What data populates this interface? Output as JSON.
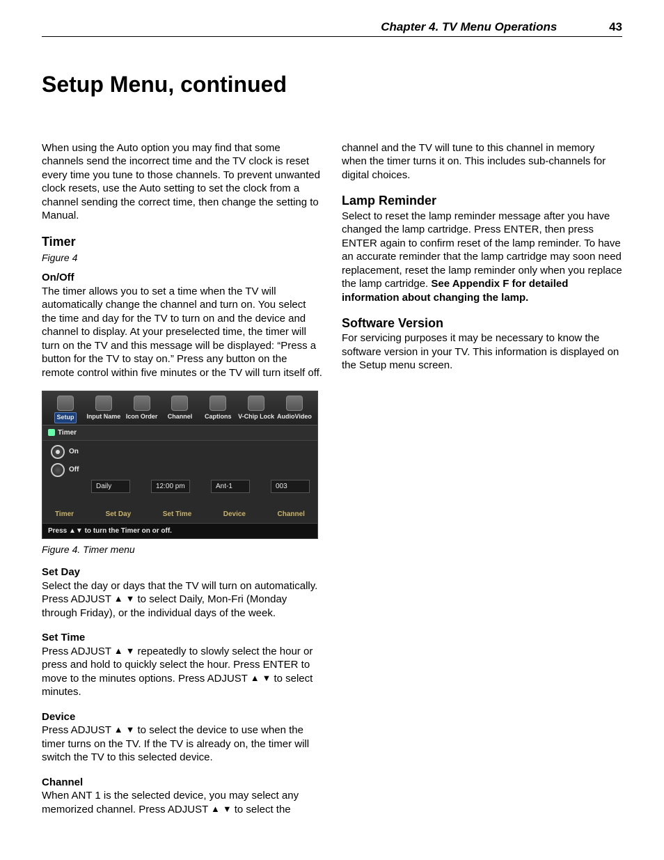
{
  "header": {
    "chapter": "Chapter 4. TV Menu Operations",
    "page": "43"
  },
  "title": "Setup Menu, continued",
  "left": {
    "intro": "When using the Auto option you may find that some channels send the incorrect time and the TV clock is reset every time you tune to those channels.  To prevent unwanted clock resets, use the Auto setting to set the clock from a channel sending the correct time, then change the setting to Manual.",
    "timer_h": "Timer",
    "timer_fig": "Figure 4",
    "onoff_h": "On/Off",
    "onoff_p": "The timer allows you to set a time when the TV will automatically change the channel and turn on.  You select the time and day for the TV to turn on and the device and channel to display.  At your preselected time, the timer will turn on the TV and this message will be displayed: “Press a button for the TV to stay on.”  Press any button on the remote control within five minutes or the TV will turn itself off.",
    "caption": "Figure 4. Timer menu",
    "setday_h": "Set Day",
    "setday_p1": "Select the day or days that the TV will turn on automatically.  Press ADJUST ",
    "setday_p2": " to select Daily, Mon-Fri (Monday through Friday), or the individual days of the week.",
    "settime_h": "Set Time",
    "settime_p1": "Press ADJUST ",
    "settime_p2": " repeatedly to slowly select the hour or press and hold to quickly select the hour.  Press ENTER to move to the minutes options.  Press ADJUST ",
    "settime_p3": " to select minutes.",
    "device_h": "Device",
    "device_p1": "Press ADJUST ",
    "device_p2": " to select the device to use when the timer turns on the TV.  If the TV is already on, the timer will switch the TV to this selected device.",
    "channel_h": "Channel",
    "channel_p1": "When ANT 1 is the selected device, you may select any memorized channel.  Press ADJUST ",
    "channel_p2": " to select the"
  },
  "right": {
    "cont": "channel and the TV will tune to this channel in memory when the timer turns it on.  This includes sub-channels for digital choices.",
    "lamp_h": "Lamp Reminder",
    "lamp_p1": "Select to reset the lamp reminder message after you have changed the lamp cartridge.  Press ENTER, then press ENTER again to confirm reset of the lamp reminder.  To have an accurate reminder that the lamp cartridge may soon need replacement, reset the lamp reminder only when you replace the lamp cartridge.  ",
    "lamp_p2": "See Appendix F for detailed information about changing the lamp.",
    "soft_h": "Software Version",
    "soft_p": "For servicing purposes it may be necessary to know the software version in your TV.  This information is displayed on the Setup menu screen."
  },
  "osd": {
    "tabs": [
      "Setup",
      "Input Name",
      "Icon Order",
      "Channel",
      "Captions",
      "V-Chip Lock",
      "AudioVideo"
    ],
    "crumb": "Timer",
    "on": "On",
    "off": "Off",
    "vals": {
      "day": "Daily",
      "time": "12:00 pm",
      "device": "Ant-1",
      "channel": "003"
    },
    "labels": [
      "Timer",
      "Set Day",
      "Set Time",
      "Device",
      "Channel"
    ],
    "hint": "Press ▲▼ to turn the Timer on or off."
  },
  "glyph": {
    "up": "▲",
    "down": "▼"
  }
}
